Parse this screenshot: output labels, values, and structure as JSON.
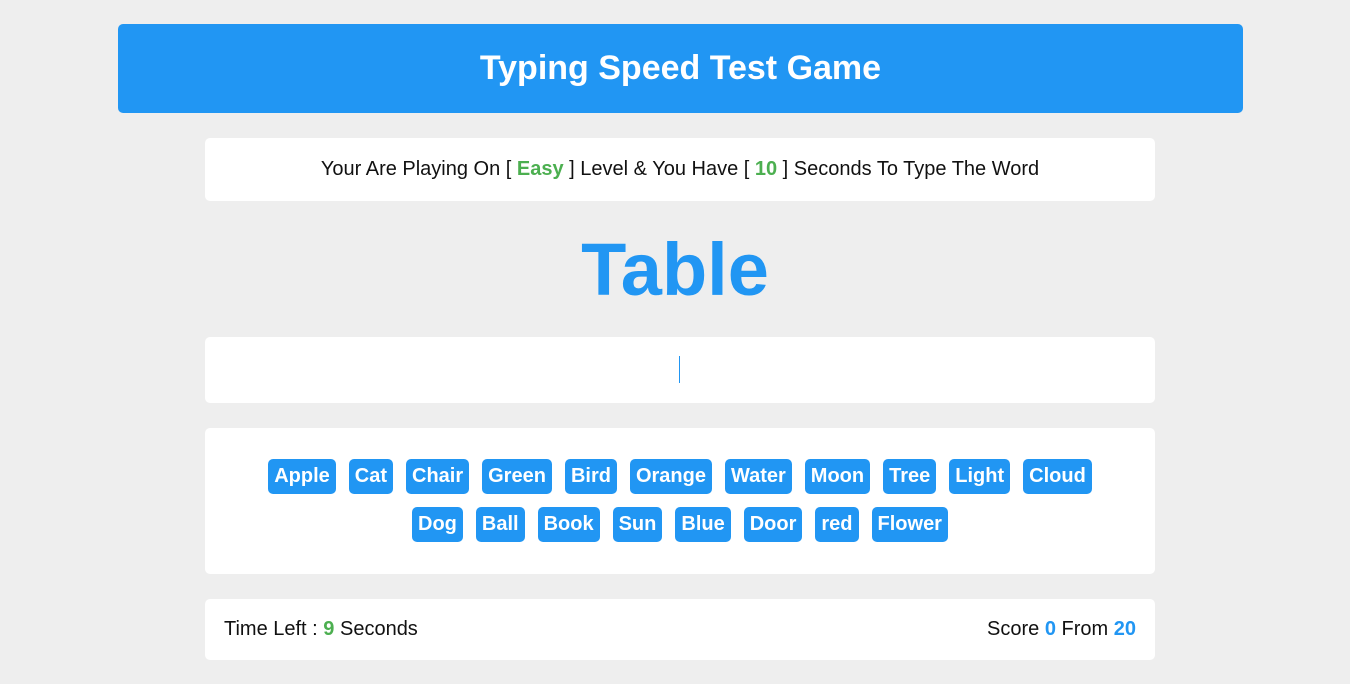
{
  "header": {
    "title": "Typing Speed Test Game"
  },
  "message": {
    "prefix": "Your Are Playing On [ ",
    "level": "Easy",
    "middle": " ] Level & You Have [ ",
    "seconds": "10",
    "suffix": " ] Seconds To Type The Word"
  },
  "current_word": "Table",
  "input": {
    "value": "",
    "placeholder": ""
  },
  "upcoming_words": [
    "Apple",
    "Cat",
    "Chair",
    "Green",
    "Bird",
    "Orange",
    "Water",
    "Moon",
    "Tree",
    "Light",
    "Cloud",
    "Dog",
    "Ball",
    "Book",
    "Sun",
    "Blue",
    "Door",
    "red",
    "Flower"
  ],
  "control": {
    "time_label": "Time Left : ",
    "time_value": "9",
    "time_unit": " Seconds",
    "score_label": "Score ",
    "score_value": "0",
    "from_label": " From ",
    "total_value": "20"
  },
  "colors": {
    "accent": "#2196f3",
    "highlight": "#4caf50",
    "background": "#eeeeee"
  }
}
